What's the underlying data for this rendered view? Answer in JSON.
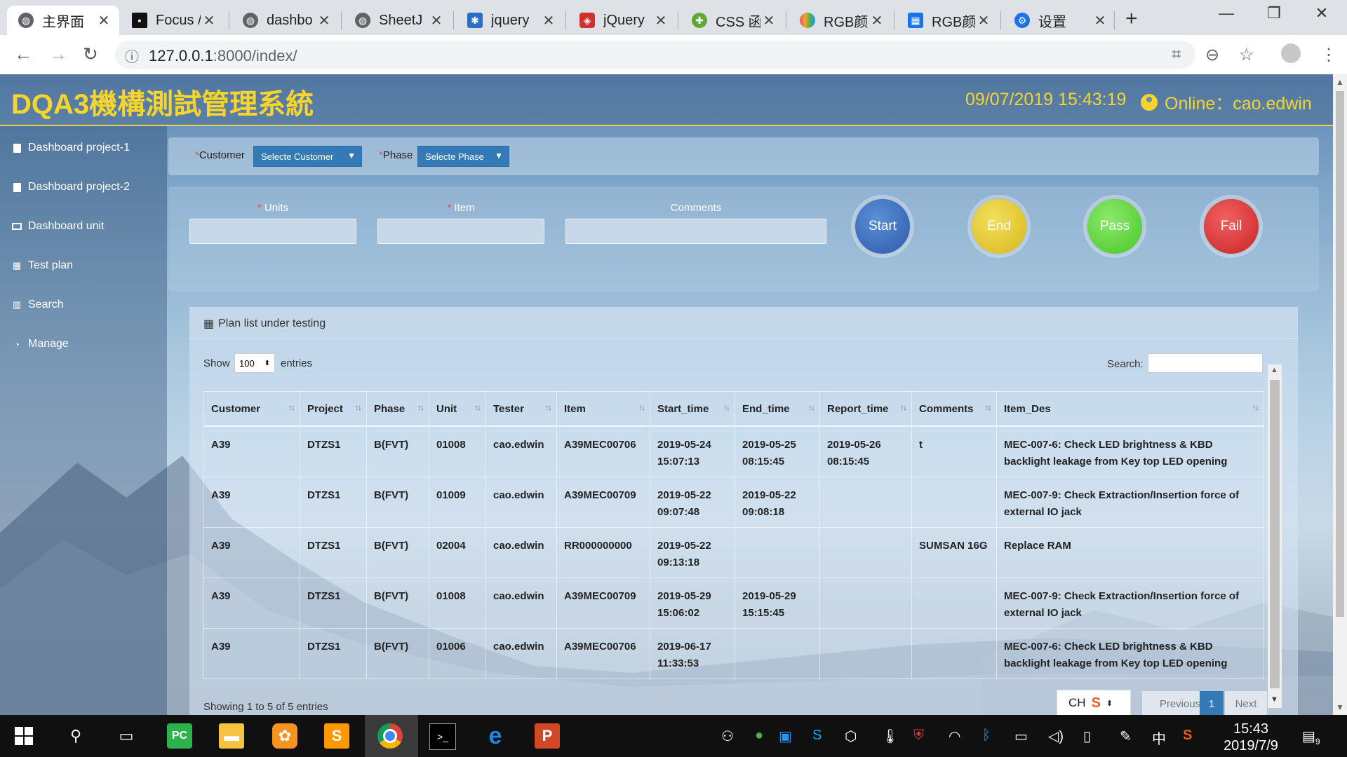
{
  "browser": {
    "tabs": [
      {
        "label": "主界面",
        "active": true,
        "fav_color": "#5f6368"
      },
      {
        "label": "Focus /",
        "fav_color": "#111111"
      },
      {
        "label": "dashbo",
        "fav_color": "#5f6368"
      },
      {
        "label": "SheetJ",
        "fav_color": "#5f6368"
      },
      {
        "label": "jquery",
        "fav_color": "#2a6ec7"
      },
      {
        "label": "jQuery",
        "fav_color": "#d32f2f"
      },
      {
        "label": "CSS 函",
        "fav_color": "#5fa832"
      },
      {
        "label": "RGB颜",
        "fav_color": "#e94e77"
      },
      {
        "label": "RGB颜",
        "fav_color": "#1a73e8"
      },
      {
        "label": "设置",
        "fav_color": "#1a73e8"
      }
    ],
    "url_host": "127.0.0.1",
    "url_rest": ":8000/index/"
  },
  "app": {
    "title": "DQA3機構測試管理系統",
    "datetime": "09/07/2019 15:43:19",
    "online_label": "Online：cao.edwin"
  },
  "sidebar": {
    "items": [
      {
        "label": "Dashboard project-1",
        "icon": "file-icon"
      },
      {
        "label": "Dashboard project-2",
        "icon": "file-icon"
      },
      {
        "label": "Dashboard unit",
        "icon": "monitor-icon"
      },
      {
        "label": "Test plan",
        "icon": "table-icon"
      },
      {
        "label": "Search",
        "icon": "map-icon"
      },
      {
        "label": "Manage",
        "icon": "dashboard-icon"
      }
    ]
  },
  "filters": {
    "customer_label": "Customer",
    "customer_value": "Selecte Customer",
    "phase_label": "Phase",
    "phase_value": "Selecte Phase",
    "required_mark": "*"
  },
  "form": {
    "units_label": "Units",
    "item_label": "Item",
    "comments_label": "Comments"
  },
  "actions": {
    "start": "Start",
    "end": "End",
    "pass": "Pass",
    "fail": "Fail",
    "colors": {
      "start": "#3a6fc4",
      "end": "#e6c92a",
      "pass": "#5fd33a",
      "fail": "#e03a3a"
    }
  },
  "table_panel": {
    "title": "Plan list under testing",
    "show_label": "Show",
    "length_value": "100",
    "entries_label": "entries",
    "search_label": "Search:",
    "columns": [
      "Customer",
      "Project",
      "Phase",
      "Unit",
      "Tester",
      "Item",
      "Start_time",
      "End_time",
      "Report_time",
      "Comments",
      "Item_Des"
    ],
    "rows": [
      [
        "A39",
        "DTZS1",
        "B(FVT)",
        "01008",
        "cao.edwin",
        "A39MEC00706",
        "2019-05-24 15:07:13",
        "2019-05-25 08:15:45",
        "2019-05-26 08:15:45",
        "t",
        "MEC-007-6: Check LED brightness & KBD backlight leakage from Key top LED opening"
      ],
      [
        "A39",
        "DTZS1",
        "B(FVT)",
        "01009",
        "cao.edwin",
        "A39MEC00709",
        "2019-05-22 09:07:48",
        "2019-05-22 09:08:18",
        "",
        "",
        "MEC-007-9: Check Extraction/Insertion force of external IO jack"
      ],
      [
        "A39",
        "DTZS1",
        "B(FVT)",
        "02004",
        "cao.edwin",
        "RR000000000",
        "2019-05-22 09:13:18",
        "",
        "",
        "SUMSAN 16G",
        "Replace RAM"
      ],
      [
        "A39",
        "DTZS1",
        "B(FVT)",
        "01008",
        "cao.edwin",
        "A39MEC00709",
        "2019-05-29 15:06:02",
        "2019-05-29 15:15:45",
        "",
        "",
        "MEC-007-9: Check Extraction/Insertion force of external IO jack"
      ],
      [
        "A39",
        "DTZS1",
        "B(FVT)",
        "01006",
        "cao.edwin",
        "A39MEC00706",
        "2019-06-17 11:33:53",
        "",
        "",
        "",
        "MEC-007-6: Check LED brightness & KBD backlight leakage from Key top LED opening"
      ]
    ],
    "info": "Showing 1 to 5 of 5 entries",
    "prev_label": "Previous",
    "page_label": "1",
    "next_label": "Next"
  },
  "ime": {
    "label": "CH"
  },
  "taskbar": {
    "time": "15:43",
    "date": "2019/7/9",
    "lang": "中",
    "notif_count": "9"
  }
}
